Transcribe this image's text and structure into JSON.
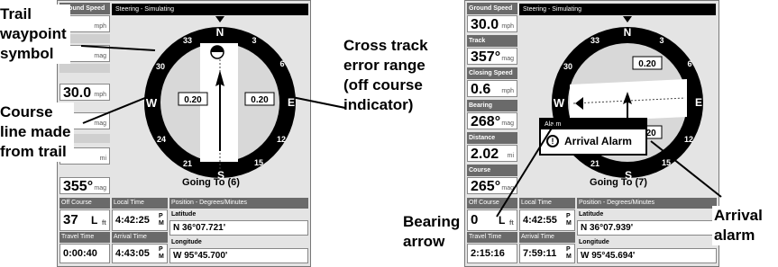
{
  "left": {
    "title": "Steering - Simulating",
    "side": [
      {
        "label": "Ground Speed",
        "value": "",
        "unit": "mph"
      },
      {
        "label": "",
        "value": "",
        "unit": "mag"
      },
      {
        "label": "",
        "value": "30.0",
        "unit": "mph"
      },
      {
        "label": "",
        "value": "",
        "unit": "mag"
      },
      {
        "label": "",
        "value": "",
        "unit": "mi"
      },
      {
        "label": "",
        "value": "355°",
        "unit": "mag"
      }
    ],
    "compass": {
      "n": "N",
      "e": "E",
      "s": "S",
      "w": "W",
      "t3": "3",
      "t6": "6",
      "t12": "12",
      "t15": "15",
      "t21": "21",
      "t24": "24",
      "t30": "30",
      "t33": "33",
      "range_left": "0.20",
      "range_right": "0.20"
    },
    "going_to": "Going To (6)",
    "bottom": {
      "off_course_label": "Off Course",
      "off_course_value": "37",
      "off_course_dir": "L",
      "off_course_unit": "ft",
      "travel_time_label": "Travel Time",
      "travel_time_value": "0:00:40",
      "local_time_label": "Local Time",
      "local_time_value": "4:42:25",
      "local_time_ampm": "P M",
      "arrival_time_label": "Arrival Time",
      "arrival_time_value": "4:43:05",
      "arrival_time_ampm": "P M",
      "position_label": "Position - Degrees/Minutes",
      "latitude_label": "Latitude",
      "latitude_value": "N   36°07.721'",
      "longitude_label": "Longitude",
      "longitude_value": "W   95°45.700'"
    }
  },
  "right": {
    "title": "Steering - Simulating",
    "side": [
      {
        "label": "Ground Speed",
        "value": "30.0",
        "unit": "mph"
      },
      {
        "label": "Track",
        "value": "357°",
        "unit": "mag"
      },
      {
        "label": "Closing Speed",
        "value": "0.6",
        "unit": "mph"
      },
      {
        "label": "Bearing",
        "value": "268°",
        "unit": "mag"
      },
      {
        "label": "Distance",
        "value": "2.02",
        "unit": "mi"
      },
      {
        "label": "Course",
        "value": "265°",
        "unit": "mag"
      }
    ],
    "compass": {
      "n": "N",
      "e": "E",
      "s": "S",
      "w": "W",
      "t3": "3",
      "t6": "6",
      "t12": "12",
      "t15": "15",
      "t21": "21",
      "t24": "24",
      "t30": "30",
      "t33": "33",
      "range_top": "0.20",
      "range_bottom": "0.20"
    },
    "going_to": "Going To (7)",
    "popup": {
      "title": "Alarm",
      "text": "Arrival Alarm",
      "icon": "!"
    },
    "bottom": {
      "off_course_label": "Off Course",
      "off_course_value": "0",
      "off_course_dir": "L",
      "off_course_unit": "ft",
      "travel_time_label": "Travel Time",
      "travel_time_value": "2:15:16",
      "local_time_label": "Local Time",
      "local_time_value": "4:42:55",
      "local_time_ampm": "P M",
      "arrival_time_label": "Arrival Time",
      "arrival_time_value": "7:59:11",
      "arrival_time_ampm": "P M",
      "position_label": "Position - Degrees/Minutes",
      "latitude_label": "Latitude",
      "latitude_value": "N   36°07.939'",
      "longitude_label": "Longitude",
      "longitude_value": "W   95°45.694'"
    }
  },
  "callouts": {
    "trail_waypoint": [
      "Trail",
      "waypoint",
      "symbol"
    ],
    "course_line": [
      "Course",
      "line made",
      "from trail"
    ],
    "cross_track": [
      "Cross track",
      "error range",
      "(off course",
      "indicator)"
    ],
    "arrival_alarm": [
      "Arrival",
      "alarm"
    ],
    "bearing_arrow": [
      "Bearing",
      "arrow"
    ]
  }
}
